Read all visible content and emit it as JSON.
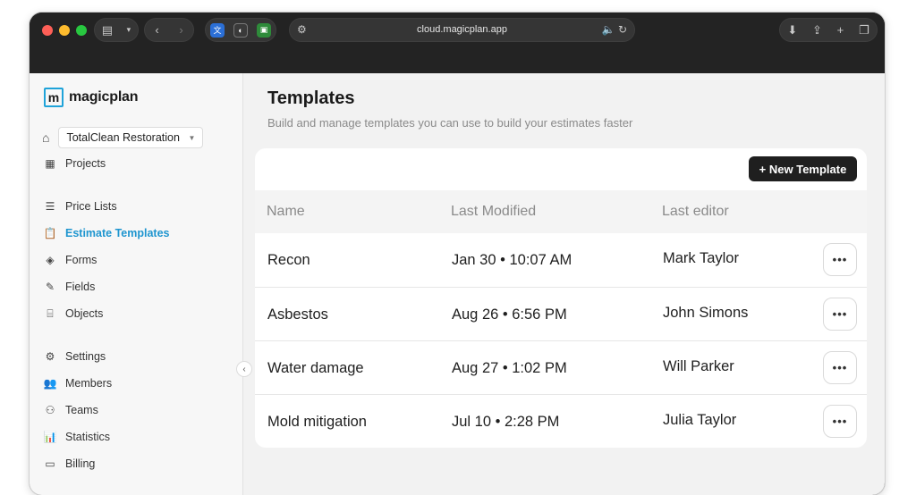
{
  "browser": {
    "url": "cloud.magicplan.app",
    "colors": {
      "chrome": "#232323",
      "red": "#fe5f57",
      "yellow": "#febc2e",
      "green": "#28c840"
    }
  },
  "app": {
    "logo_letter": "m",
    "logo_text": "magicplan",
    "accent_color": "#1fa3d9",
    "org_name": "TotalClean Restoration"
  },
  "sidebar": {
    "items": [
      {
        "label": "Projects",
        "icon": "grid-icon"
      },
      {
        "label": "Price Lists",
        "icon": "list-icon"
      },
      {
        "label": "Estimate Templates",
        "icon": "clipboard-icon",
        "active": true
      },
      {
        "label": "Forms",
        "icon": "cube-icon"
      },
      {
        "label": "Fields",
        "icon": "edit-icon"
      },
      {
        "label": "Objects",
        "icon": "object-icon"
      },
      {
        "label": "Settings",
        "icon": "gear-icon"
      },
      {
        "label": "Members",
        "icon": "members-icon"
      },
      {
        "label": "Teams",
        "icon": "teams-icon"
      },
      {
        "label": "Statistics",
        "icon": "chart-icon"
      },
      {
        "label": "Billing",
        "icon": "card-icon"
      }
    ]
  },
  "main": {
    "title": "Templates",
    "subtitle": "Build and manage templates you can use to build your estimates faster",
    "new_button_label": "+ New Template",
    "columns": [
      "Name",
      "Last Modified",
      "Last editor"
    ],
    "rows": [
      {
        "name": "Recon",
        "modified": "Jan 30 • 10:07 AM",
        "editor": "Mark Taylor"
      },
      {
        "name": "Asbestos",
        "modified": "Aug 26 • 6:56 PM",
        "editor": "John Simons"
      },
      {
        "name": "Water damage",
        "modified": "Aug 27 • 1:02 PM",
        "editor": "Will Parker"
      },
      {
        "name": "Mold mitigation",
        "modified": "Jul 10 • 2:28 PM",
        "editor": "Julia Taylor"
      }
    ],
    "more_label": "•••"
  }
}
